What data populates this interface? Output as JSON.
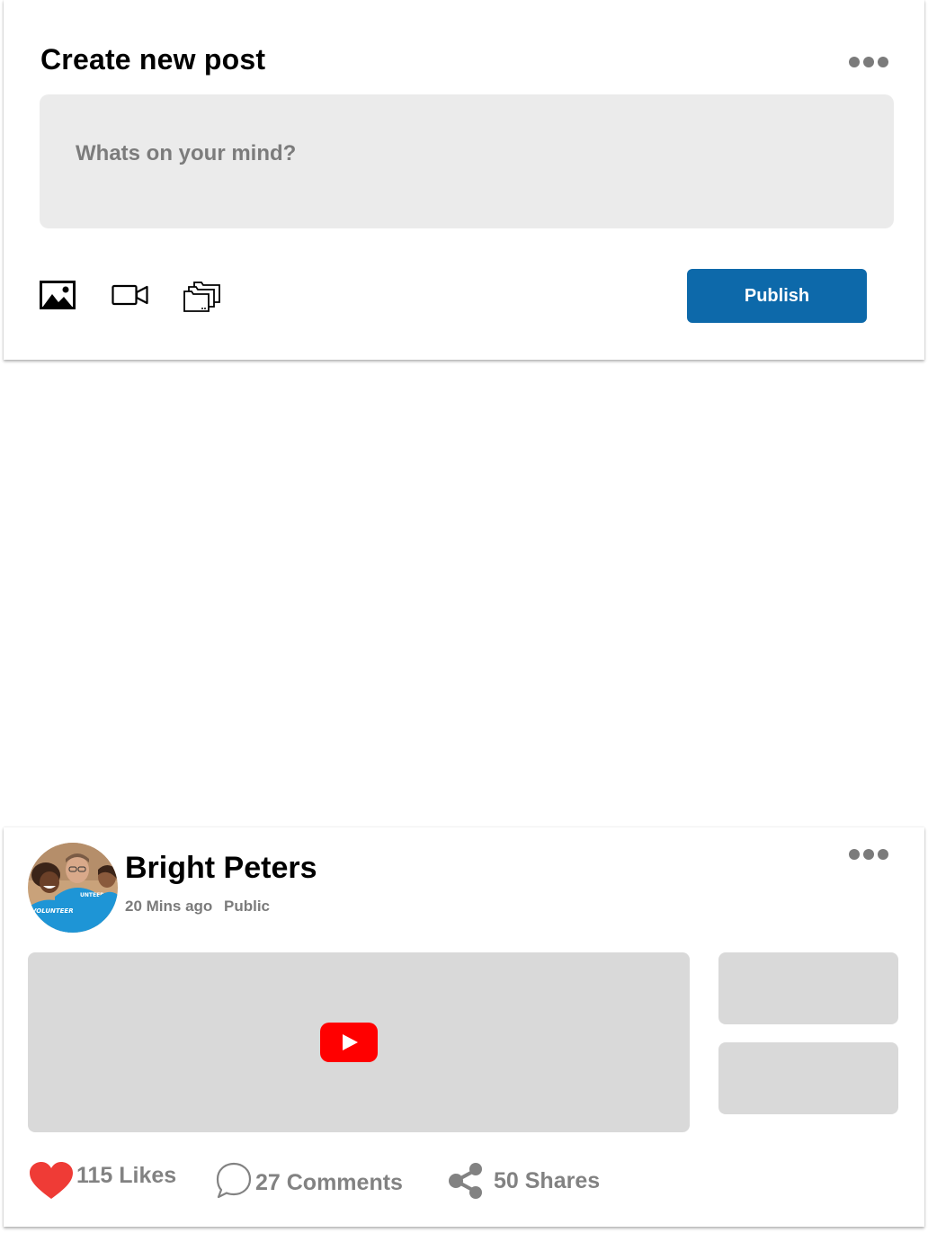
{
  "composer": {
    "title": "Create new post",
    "placeholder": "Whats on your mind?",
    "publish_label": "Publish",
    "tools": [
      "image-icon",
      "video-camera-icon",
      "folders-icon"
    ]
  },
  "post": {
    "author": "Bright Peters",
    "time_ago": "20 Mins ago",
    "visibility": "Public",
    "avatar_text": [
      "VOLUNTEER",
      "UNTEER"
    ],
    "likes_label": "115 Likes",
    "comments_label": "27 Comments",
    "shares_label": "50 Shares"
  },
  "colors": {
    "accent": "#0d69aa",
    "like_red": "#ef3b36",
    "youtube_red": "#ff0000",
    "placeholder_gray": "#d9d9d9",
    "input_gray": "#ebebeb",
    "muted_text": "#7b7b7b"
  }
}
